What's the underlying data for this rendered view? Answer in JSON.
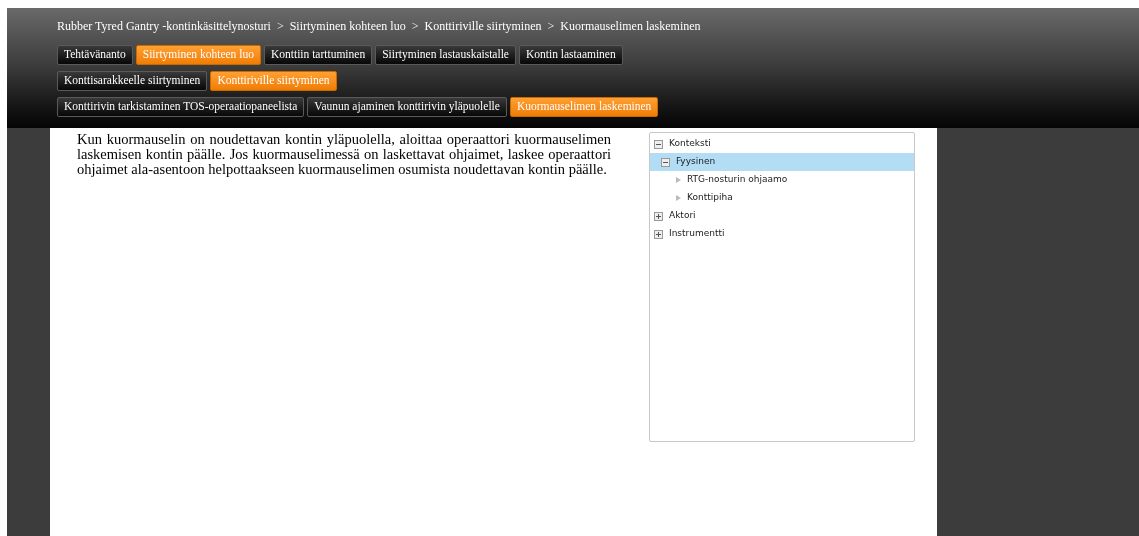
{
  "breadcrumb": {
    "separator": ">",
    "items": [
      "Rubber Tyred Gantry -kontinkäsittelynosturi",
      "Siirtyminen kohteen luo",
      "Konttiriville siirtyminen",
      "Kuormauselimen laskeminen"
    ]
  },
  "tab_rows": [
    [
      {
        "label": "Tehtävänanto",
        "selected": false
      },
      {
        "label": "Siirtyminen kohteen luo",
        "selected": true
      },
      {
        "label": "Konttiin tarttuminen",
        "selected": false
      },
      {
        "label": "Siirtyminen lastauskaistalle",
        "selected": false
      },
      {
        "label": "Kontin lastaaminen",
        "selected": false
      }
    ],
    [
      {
        "label": "Konttisarakkeelle siirtyminen",
        "selected": false
      },
      {
        "label": "Konttiriville siirtyminen",
        "selected": true
      }
    ],
    [
      {
        "label": "Konttirivin tarkistaminen TOS-operaatiopaneelista",
        "selected": false
      },
      {
        "label": "Vaunun ajaminen konttirivin yläpuolelle",
        "selected": false
      },
      {
        "label": "Kuormauselimen laskeminen",
        "selected": true
      }
    ]
  ],
  "description": "Kun kuormauselin on noudettavan kontin yläpuolella, aloittaa operaattori kuormauselimen laskemisen kontin päälle. Jos kuormauselimessä on laskettavat ohjaimet, laskee operaattori ohjaimet ala-asentoon helpottaakseen kuormauselimen osumista noudettavan kontin päälle.",
  "tree": [
    {
      "label": "Konteksti",
      "kind": "group",
      "expanded": true,
      "selected": false,
      "children": [
        {
          "label": "Fyysinen",
          "kind": "group",
          "expanded": true,
          "selected": true,
          "children": [
            {
              "label": "RTG-nosturin ohjaamo",
              "kind": "leaf",
              "selected": false
            },
            {
              "label": "Konttipiha",
              "kind": "leaf",
              "selected": false
            }
          ]
        }
      ]
    },
    {
      "label": "Aktori",
      "kind": "group",
      "expanded": false,
      "selected": false
    },
    {
      "label": "Instrumentti",
      "kind": "group",
      "expanded": false,
      "selected": false
    }
  ]
}
